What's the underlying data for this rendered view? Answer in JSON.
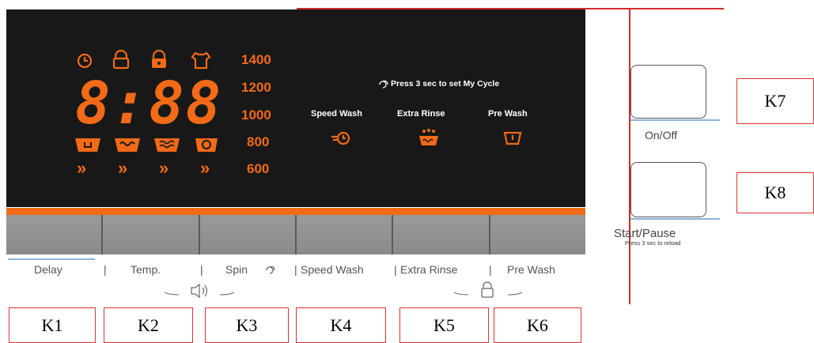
{
  "display": {
    "digits": "8:88",
    "status_icons": [
      "clock-icon",
      "lock-icon",
      "child-lock-icon",
      "shirt-icon"
    ],
    "temp_icons": [
      "tub-icon",
      "tub-wave-icon",
      "tub-hot-icon",
      "spin-drum-icon"
    ],
    "arrows": [
      "»",
      "»",
      "»",
      "»"
    ],
    "spin_speeds": [
      "1400",
      "1200",
      "1000",
      "800",
      "600"
    ],
    "my_cycle_note": "Press 3 sec to set My Cycle",
    "options": [
      {
        "label": "Speed Wash",
        "icon": "speed-wash-icon"
      },
      {
        "label": "Extra Rinse",
        "icon": "extra-rinse-icon"
      },
      {
        "label": "Pre Wash",
        "icon": "pre-wash-icon"
      }
    ]
  },
  "labels": {
    "delay": "Delay",
    "temp": "Temp.",
    "spin": "Spin",
    "speed_wash": "Speed Wash",
    "extra_rinse": "Extra Rinse",
    "pre_wash": "Pre Wash",
    "separator": "|"
  },
  "right_buttons": {
    "on_off": "On/Off",
    "start_pause": "Start/Pause",
    "start_pause_note": "Press 3 sec to reload"
  },
  "keys": [
    "K1",
    "K2",
    "K3",
    "K4",
    "K5",
    "K6",
    "K7",
    "K8"
  ],
  "colors": {
    "accent": "#f26a17",
    "panel": "#181818",
    "frame": "#d32b2b"
  }
}
